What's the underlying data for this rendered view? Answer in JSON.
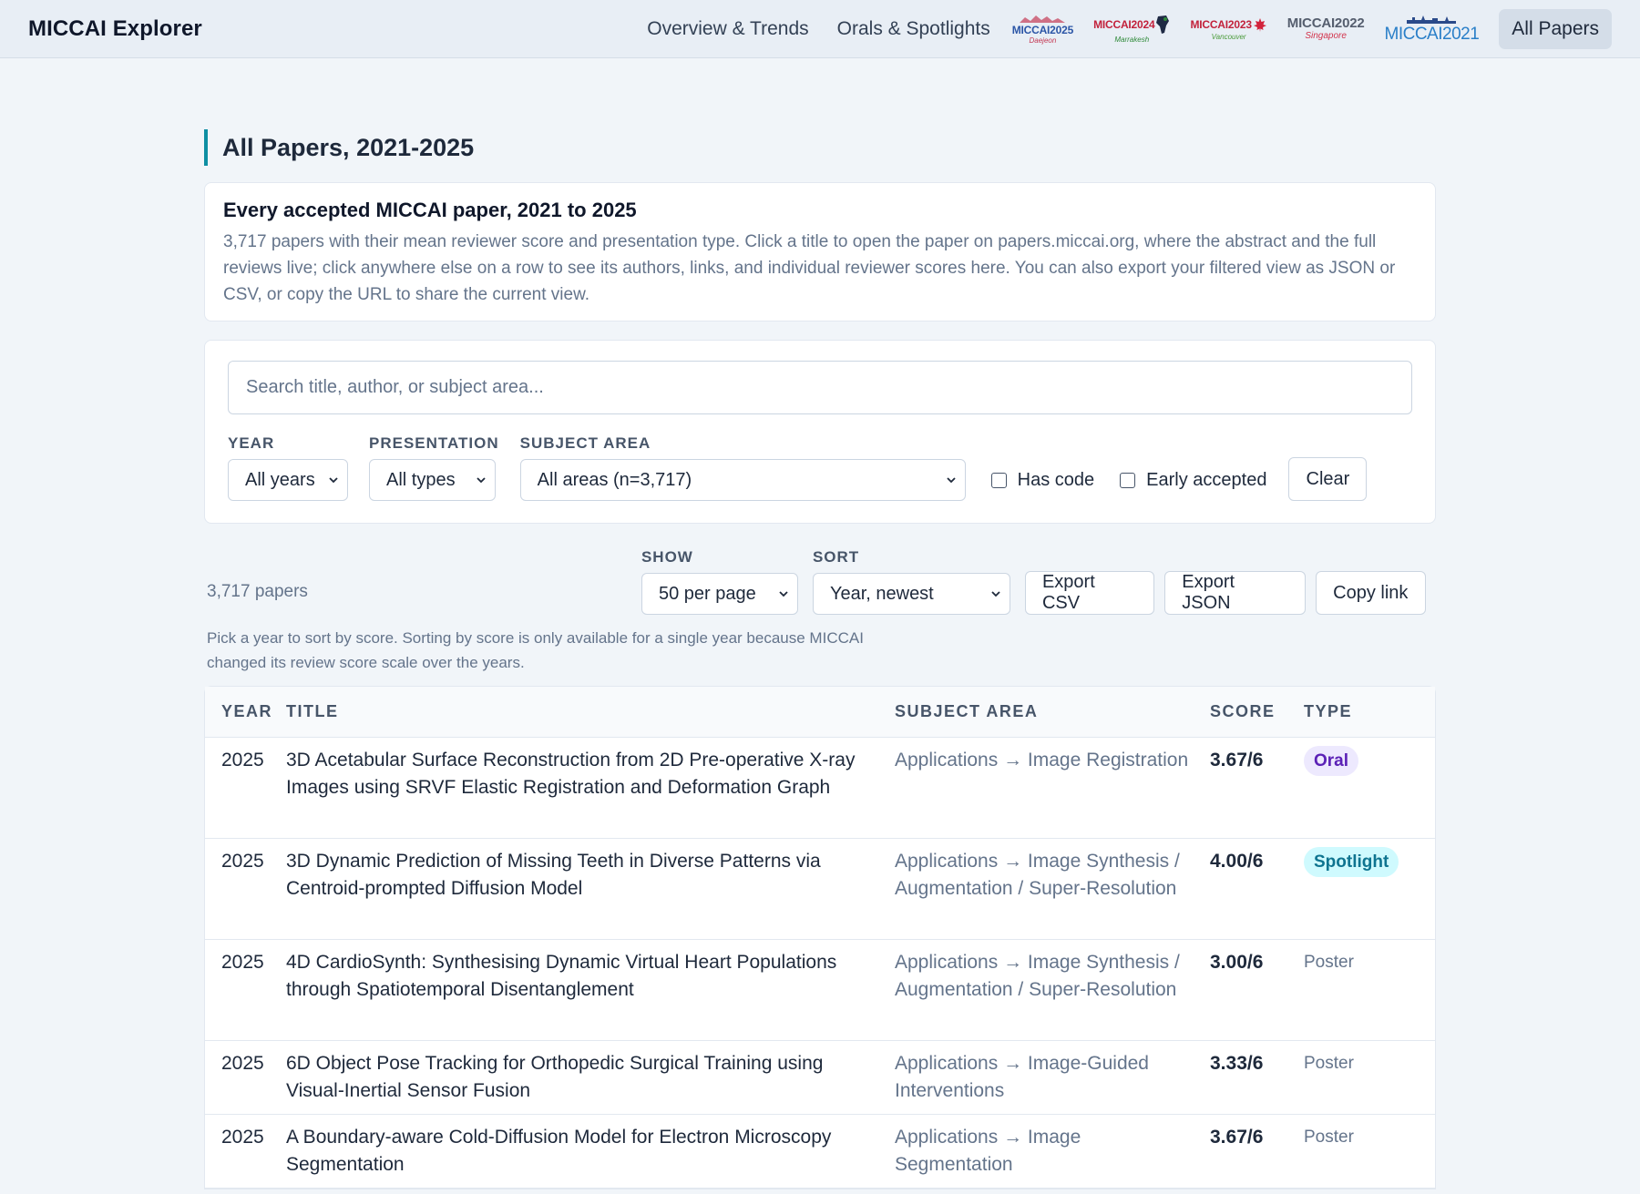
{
  "nav": {
    "brand": "MICCAI Explorer",
    "links": [
      "Overview & Trends",
      "Orals & Spotlights"
    ],
    "logos": [
      {
        "text": "MICCAI2025",
        "sub": "Daejeon",
        "color": "#2b55a6",
        "sub_color": "#c43a55"
      },
      {
        "text": "MICCAI2024",
        "sub": "Marrakesh",
        "color": "#c2213b",
        "sub_color": "#2f8a3a"
      },
      {
        "text": "MICCAI2023",
        "sub": "Vancouver",
        "color": "#c2213b",
        "sub_color": "#4a9b3a"
      },
      {
        "text": "MICCAI2022",
        "sub": "Singapore",
        "color": "#555e6e",
        "sub_color": "#d2334c"
      },
      {
        "text": "MICCAI2021",
        "sub": "",
        "color": "#2a7fc8",
        "sub_color": "#2a7fc8"
      }
    ],
    "active": "All Papers"
  },
  "page": {
    "title": "All Papers, 2021-2025",
    "intro_heading": "Every accepted MICCAI paper, 2021 to 2025",
    "intro_text": "3,717 papers with their mean reviewer score and presentation type. Click a title to open the paper on papers.miccai.org, where the abstract and the full reviews live; click anywhere else on a row to see its authors, links, and individual reviewer scores here. You can also export your filtered view as JSON or CSV, or copy the URL to share the current view."
  },
  "filters": {
    "search_placeholder": "Search title, author, or subject area...",
    "year_label": "YEAR",
    "year_value": "All years",
    "presentation_label": "PRESENTATION",
    "presentation_value": "All types",
    "subject_label": "SUBJECT AREA",
    "subject_value": "All areas (n=3,717)",
    "has_code": "Has code",
    "early_accepted": "Early accepted",
    "clear": "Clear"
  },
  "toolbar": {
    "count": "3,717 papers",
    "show_label": "SHOW",
    "show_value": "50 per page",
    "sort_label": "SORT",
    "sort_value": "Year, newest",
    "export_csv": "Export CSV",
    "export_json": "Export JSON",
    "copy_link": "Copy link",
    "note": "Pick a year to sort by score. Sorting by score is only available for a single year because MICCAI changed its review score scale over the years."
  },
  "table": {
    "headers": {
      "year": "YEAR",
      "title": "TITLE",
      "subject": "SUBJECT AREA",
      "score": "SCORE",
      "type": "TYPE"
    },
    "rows": [
      {
        "year": "2025",
        "title": "3D Acetabular Surface Reconstruction from 2D Pre-operative X-ray Images using SRVF Elastic Registration and Deformation Graph",
        "subject": "Applications → Image Registration",
        "score": "3.67/6",
        "type": "Oral"
      },
      {
        "year": "2025",
        "title": "3D Dynamic Prediction of Missing Teeth in Diverse Patterns via Centroid-prompted Diffusion Model",
        "subject": "Applications → Image Synthesis / Augmentation / Super-Resolution",
        "score": "4.00/6",
        "type": "Spotlight"
      },
      {
        "year": "2025",
        "title": "4D CardioSynth: Synthesising Dynamic Virtual Heart Populations through Spatiotemporal Disentanglement",
        "subject": "Applications → Image Synthesis / Augmentation / Super-Resolution",
        "score": "3.00/6",
        "type": "Poster"
      },
      {
        "year": "2025",
        "title": "6D Object Pose Tracking for Orthopedic Surgical Training using Visual-Inertial Sensor Fusion",
        "subject": "Applications → Image-Guided Interventions",
        "score": "3.33/6",
        "type": "Poster"
      },
      {
        "year": "2025",
        "title": "A Boundary-aware Cold-Diffusion Model for Electron Microscopy Segmentation",
        "subject": "Applications → Image Segmentation",
        "score": "3.67/6",
        "type": "Poster"
      }
    ]
  }
}
